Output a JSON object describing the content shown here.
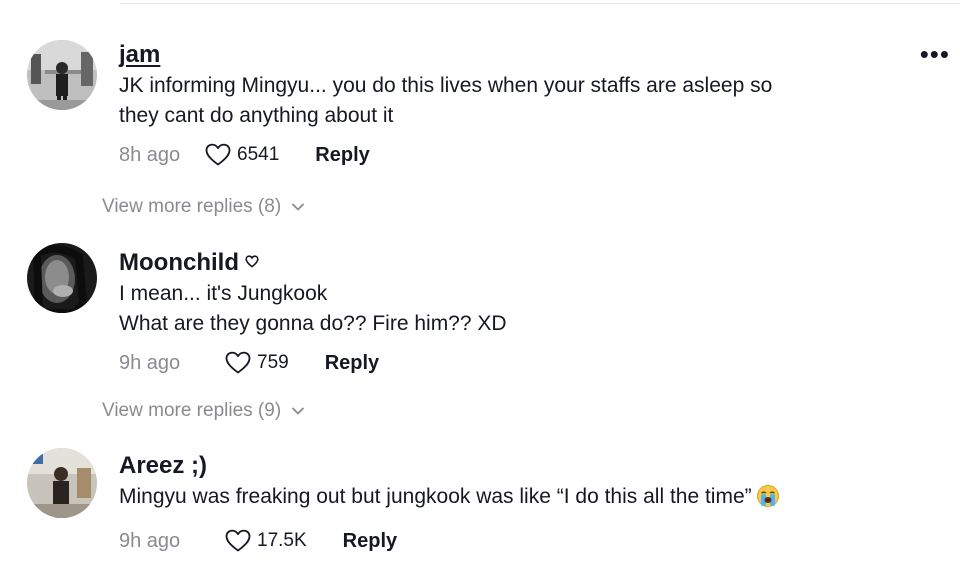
{
  "comments": [
    {
      "username": "jam",
      "text_lines": [
        "JK informing Mingyu... you do this lives when your staffs are asleep so",
        "they cant do anything about it"
      ],
      "time": "8h ago",
      "likes": "6541",
      "reply_label": "Reply",
      "more_replies": "View more replies (8)",
      "options_icon": "more-horizontal-icon"
    },
    {
      "username": "Moonchild",
      "name_badge_icon": "heart-outline-icon",
      "text_lines": [
        "I mean... it's Jungkook",
        "What are they gonna do?? Fire him?? XD"
      ],
      "time": "9h ago",
      "likes": "759",
      "reply_label": "Reply",
      "more_replies": "View more replies (9)"
    },
    {
      "username": "Areez ;)",
      "text_lines": [
        "Mingyu was freaking out but jungkook was like “I do this all the time”"
      ],
      "trailing_emoji": "loudly-crying-face",
      "time": "9h ago",
      "likes": "17.5K",
      "reply_label": "Reply"
    }
  ],
  "colors": {
    "text": "#161823",
    "muted": "#8a8b91",
    "divider": "#e6e6e6"
  },
  "icons": {
    "like": "heart-outline-icon",
    "expand": "chevron-down-icon"
  }
}
